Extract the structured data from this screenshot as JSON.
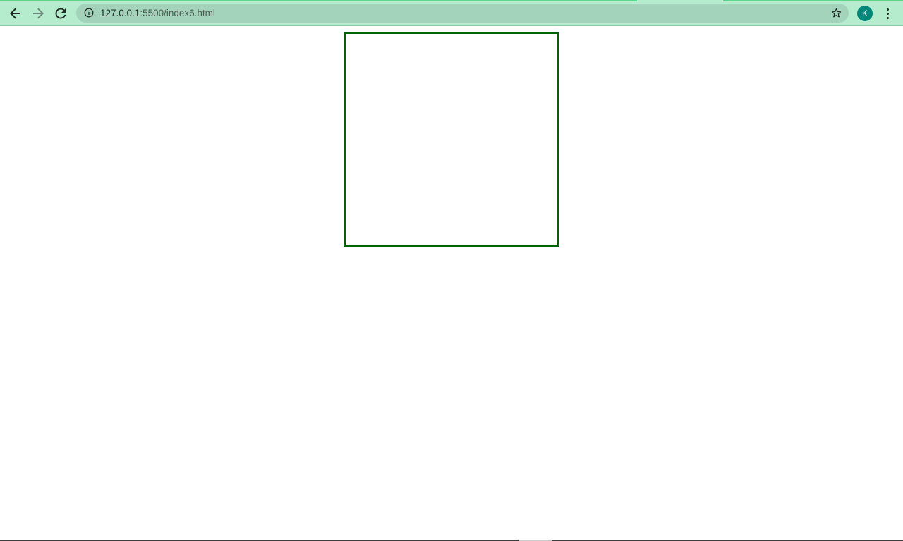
{
  "browser": {
    "url_host": "127.0.0.1",
    "url_rest": ":5500/index6.html",
    "profile_initial": "K"
  },
  "icons": {
    "back": "back-arrow-icon",
    "forward": "forward-arrow-icon",
    "reload": "reload-icon",
    "site_info": "info-icon",
    "bookmark": "star-icon",
    "menu": "kebab-menu-icon"
  },
  "colors": {
    "toolbar": "#b5eccd",
    "omnibox": "#a3d4bb",
    "avatar": "#00897b",
    "box_border": "#006400"
  }
}
